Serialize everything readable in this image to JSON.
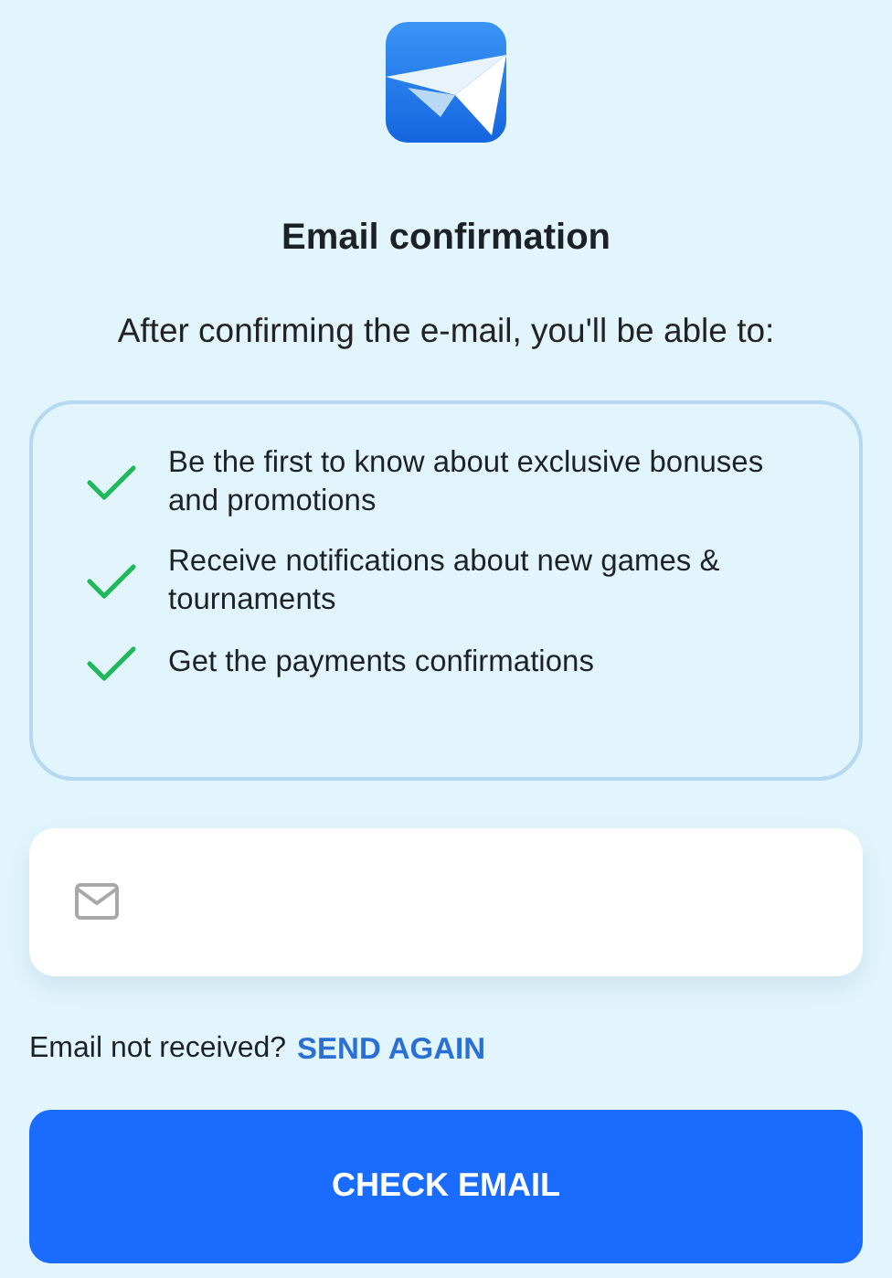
{
  "title": "Email confirmation",
  "subtitle": "After confirming the e-mail, you'll be able to:",
  "benefits": [
    {
      "text": "Be the first to know about exclusive bonuses and promotions"
    },
    {
      "text": "Receive notifications about new games & tournaments"
    },
    {
      "text": "Get the payments confirmations"
    }
  ],
  "email_field": {
    "kind": "email"
  },
  "resend": {
    "question": "Email not received?",
    "link": "SEND AGAIN"
  },
  "buttons": [
    "CHECK EMAIL"
  ]
}
